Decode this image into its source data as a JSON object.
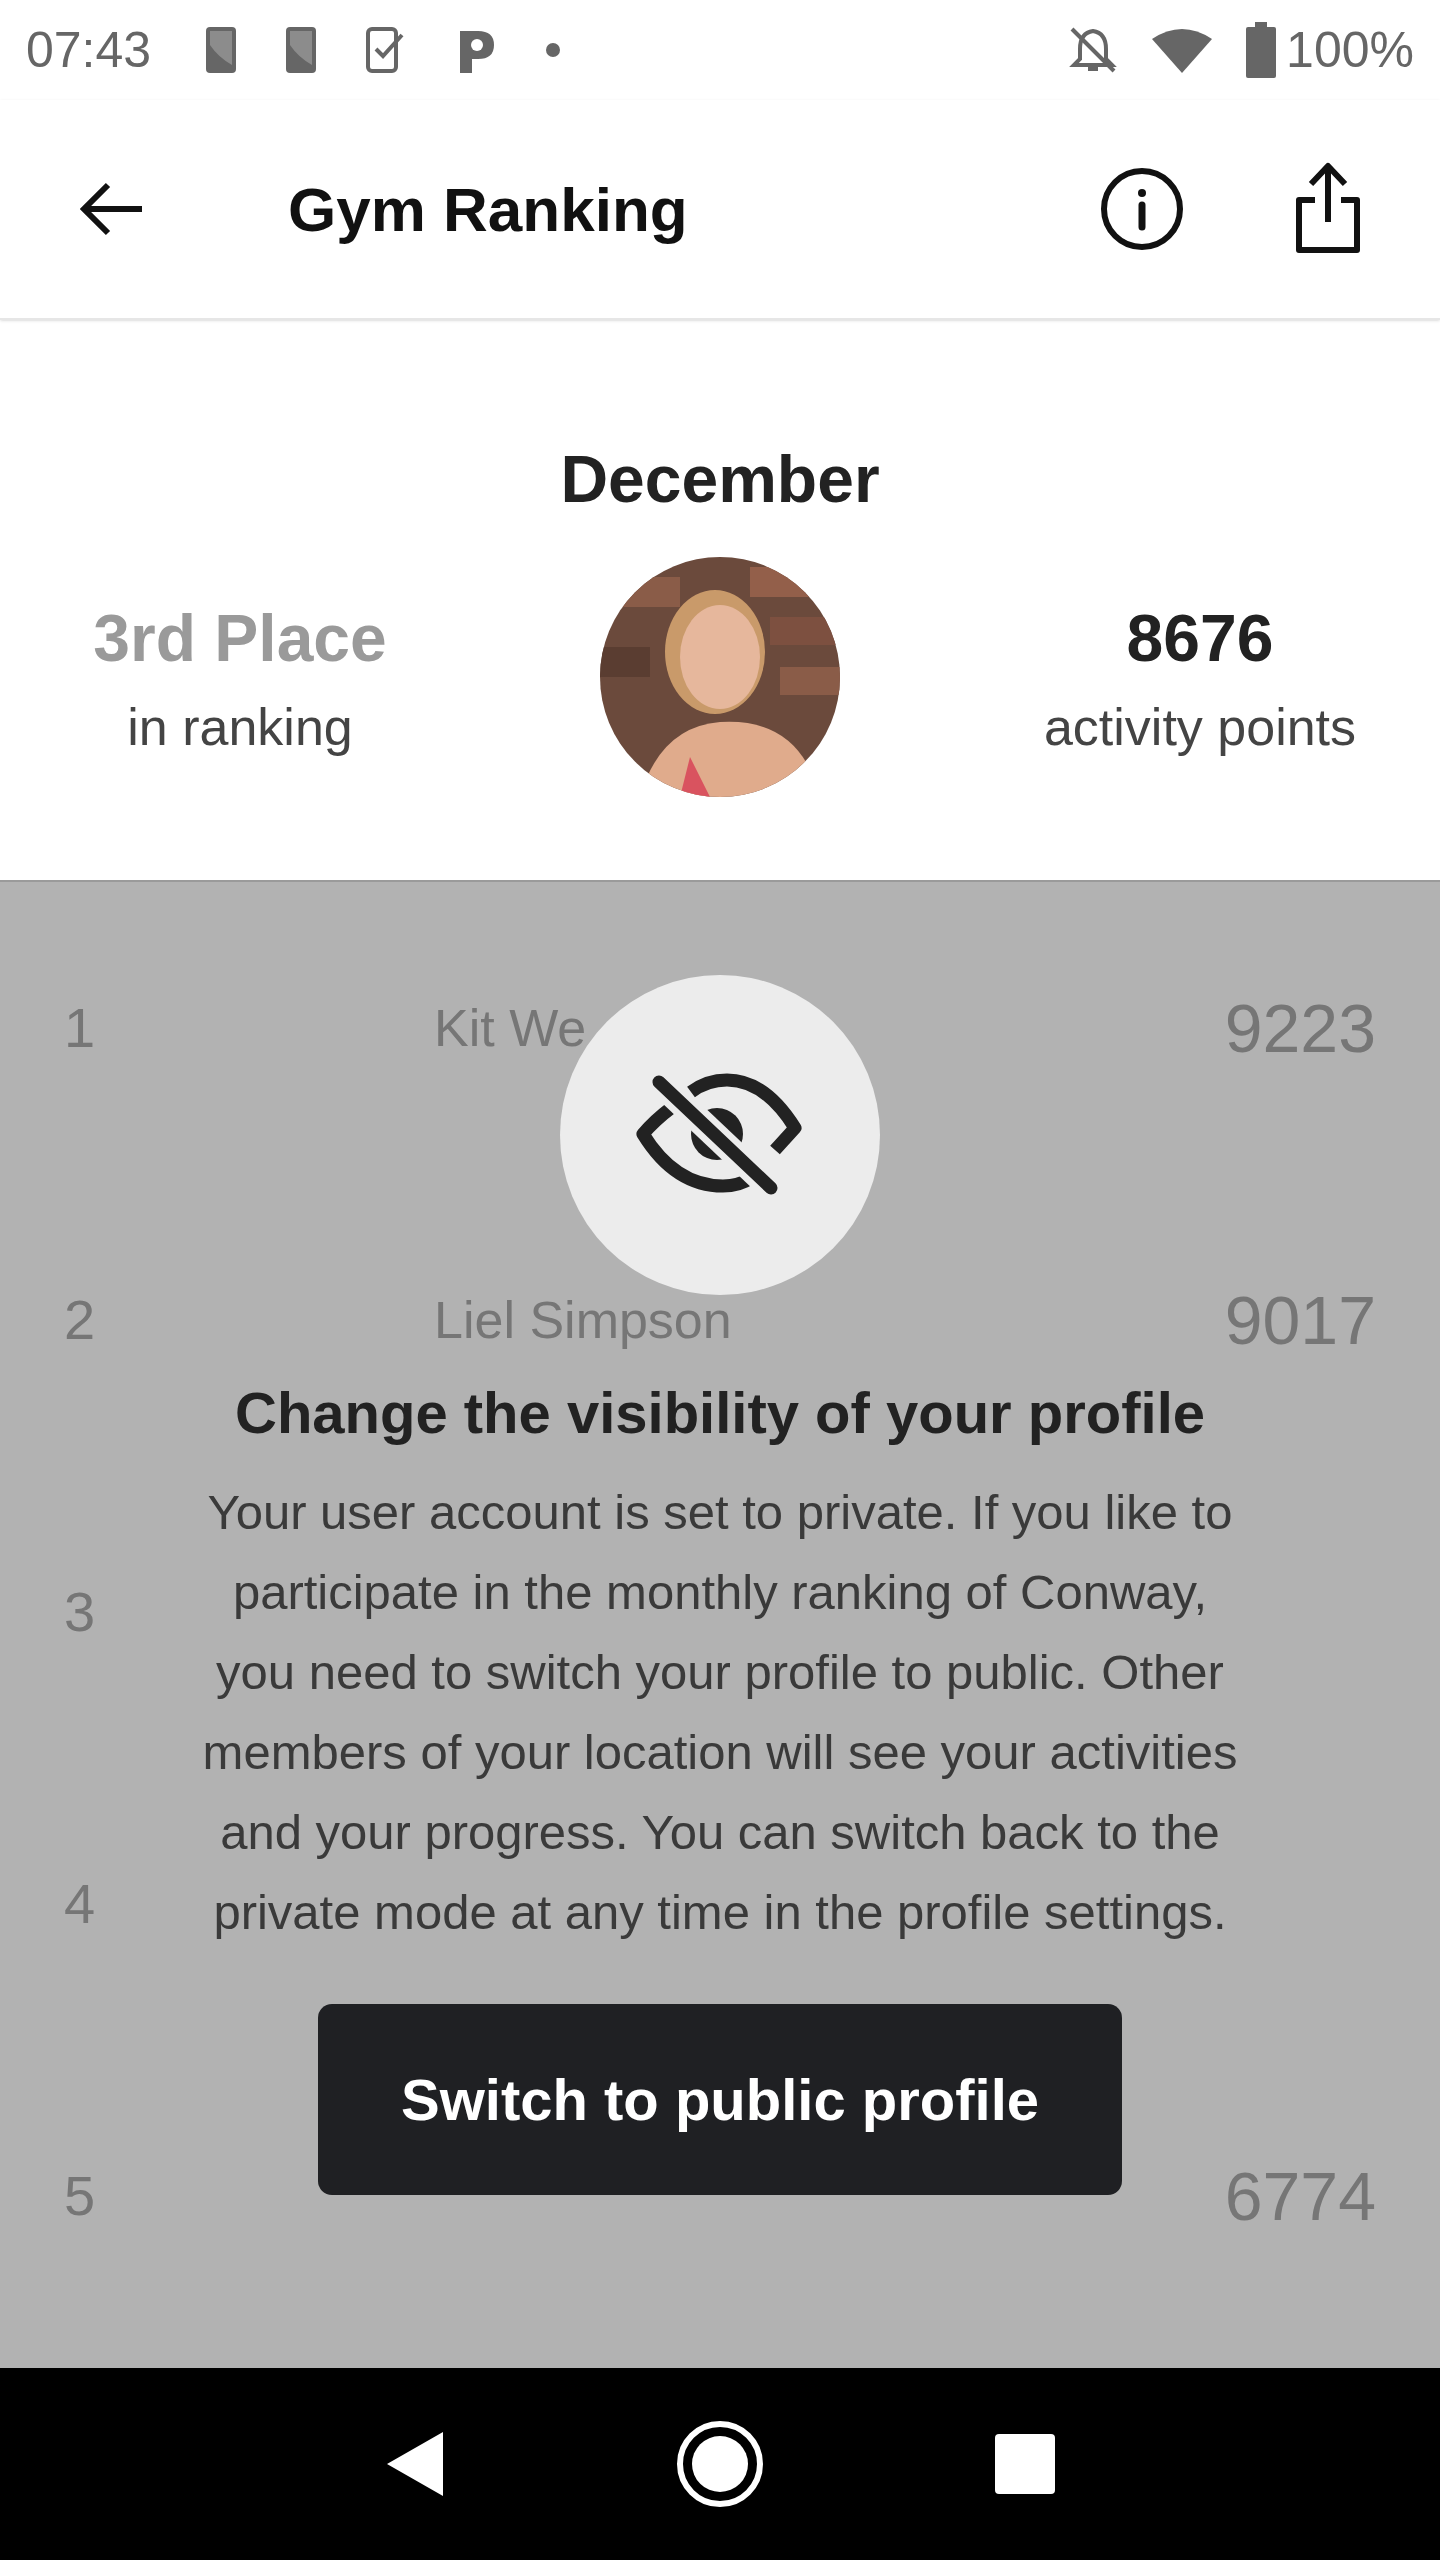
{
  "status_bar": {
    "time": "07:43",
    "battery": "100%"
  },
  "app_bar": {
    "title": "Gym Ranking"
  },
  "summary": {
    "month": "December",
    "place": "3rd Place",
    "place_caption": "in ranking",
    "points": "8676",
    "points_caption": "activity points"
  },
  "ranking_rows": [
    {
      "rank": "1",
      "name": "Kit We",
      "points": "9223"
    },
    {
      "rank": "2",
      "name": "Liel Simpson",
      "points": "9017"
    },
    {
      "rank": "3"
    },
    {
      "rank": "4"
    },
    {
      "rank": "5",
      "points": "6774"
    }
  ],
  "dialog": {
    "title": "Change the visibility of your profile",
    "message": "Your user account is set to private. If you like to participate in the monthly ranking of Conway, you need to switch your profile to public. Other members of your location will see your activities and your progress. You can switch back to the private mode at any time in the profile settings.",
    "button": "Switch to public profile"
  }
}
